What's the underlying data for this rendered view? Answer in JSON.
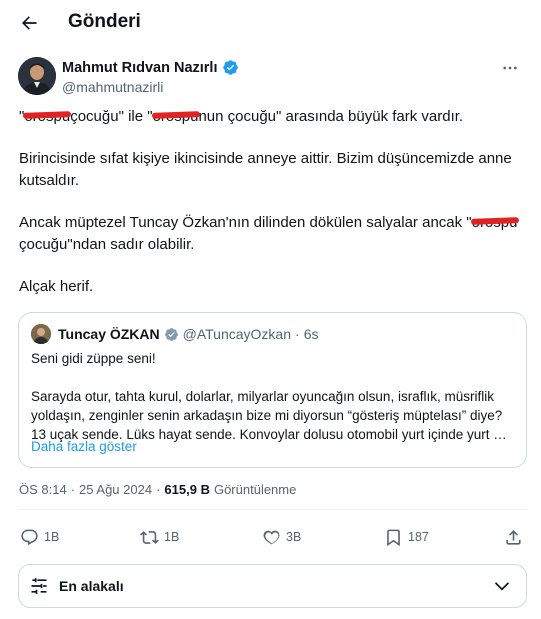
{
  "header": {
    "title": "Gönderi"
  },
  "author": {
    "name": "Mahmut Rıdvan Nazırlı",
    "handle": "@mahmutnazirli"
  },
  "tweet": {
    "p1_a": "\"",
    "p1_censored": "orospu",
    "p1_b": "çocuğu\" ile \"",
    "p1_censored2": "orospu",
    "p1_c": "nun çocuğu\" arasında büyük fark vardır.",
    "p2": "Birincisinde sıfat kişiye ikincisinde anneye aittir. Bizim düşüncemizde anne kutsaldır.",
    "p3_a": "Ancak müptezel Tuncay Özkan'nın dilinden dökülen salyalar ancak \"",
    "p3_censored": "orospu",
    "p3_b": "çocuğu\"ndan sadır olabilir.",
    "p4": "Alçak herif."
  },
  "quote": {
    "name": "Tuncay ÖZKAN",
    "handle": "@ATuncayOzkan",
    "sep": "·",
    "time": "6s",
    "line1": "Seni gidi züppe seni!",
    "line2": "Sarayda otur, tahta kurul, dolarlar, milyarlar oyuncağın olsun, israflık, müsriflik yoldaşın, zenginler senin arkadaşın bize mi diyorsun “gösteriş müptelası” diye? 13 uçak sende. Lüks hayat sende. Konvoylar dolusu otomobil yurt içinde yurt …",
    "show_more": "Daha fazla göster"
  },
  "meta": {
    "time": "ÖS 8:14",
    "sep": "·",
    "date": "25 Ağu 2024",
    "sep2": "·",
    "views_count": "615,9 B",
    "views_label": "Görüntülenme"
  },
  "actions": {
    "replies": "1B",
    "reposts": "1B",
    "likes": "3B",
    "bookmarks": "187"
  },
  "sort": {
    "label": "En alakalı"
  },
  "colors": {
    "link": "#1d9bf0",
    "verified": "#1d9bf0",
    "muted": "#536471",
    "censor": "#e02424"
  }
}
